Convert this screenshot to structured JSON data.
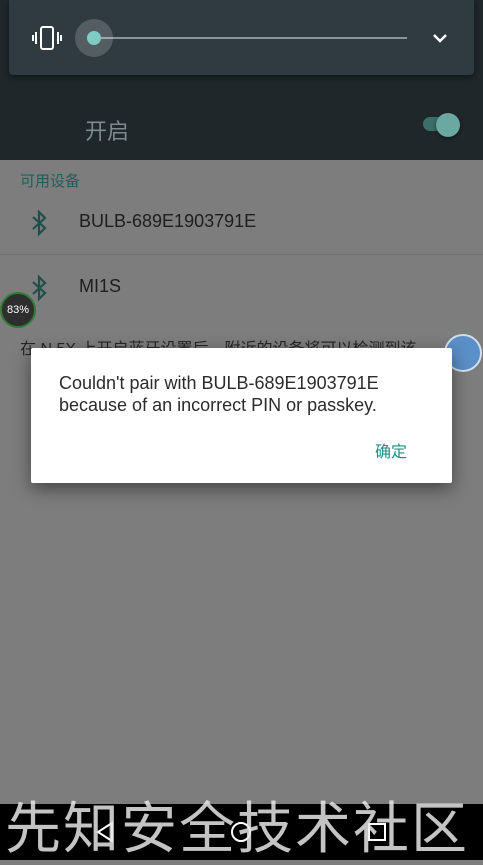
{
  "volume_panel": {
    "level_fraction": 0.02,
    "vibrate_icon": "vibrate-icon",
    "expand_icon": "chevron-down-icon"
  },
  "bluetooth_switch": {
    "label": "开启",
    "on": true
  },
  "available_devices": {
    "title": "可用设备",
    "items": [
      {
        "name": "BULB-689E1903791E",
        "icon": "bluetooth-icon"
      },
      {
        "name": "MI1S",
        "icon": "bluetooth-icon"
      }
    ]
  },
  "hint": {
    "text": "在 N      5X 上开启蓝牙设置后，附近的设备将可以检测到该"
  },
  "battery_badge": {
    "text": "83%"
  },
  "dialog": {
    "message": "Couldn't pair with BULB-689E1903791E because of an incorrect PIN or passkey.",
    "ok_label": "确定"
  },
  "watermark": {
    "text": "先知安全技术社区"
  },
  "colors": {
    "accent": "#1f8f84",
    "header": "#1f272b",
    "scrim": "#7d7d7d"
  }
}
